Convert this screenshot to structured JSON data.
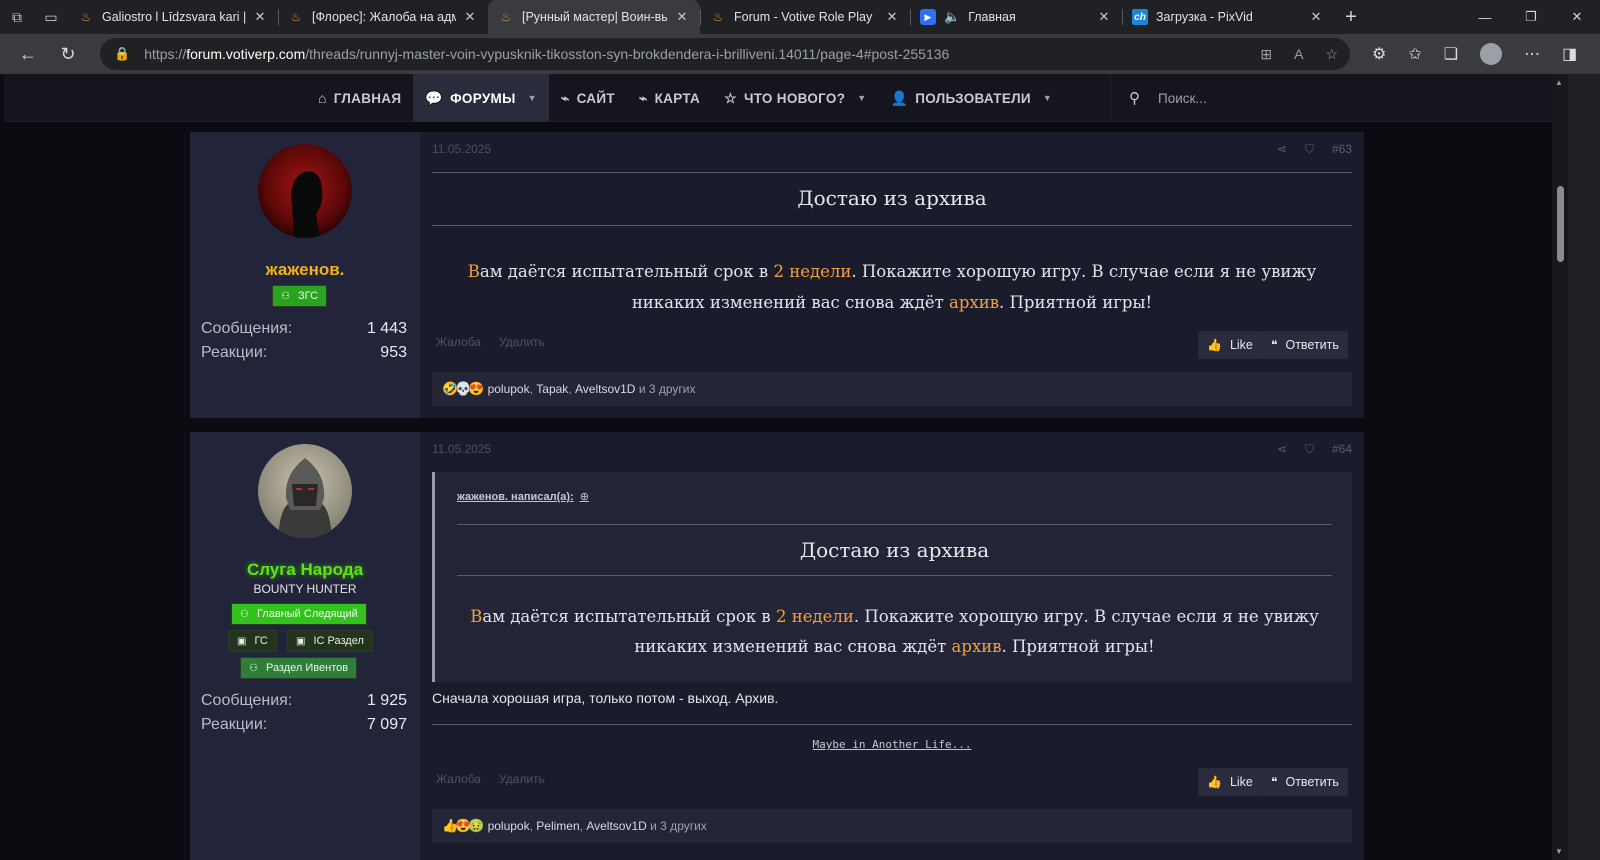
{
  "browser": {
    "tabs": [
      {
        "title": "Galiostro l Līdzsvara kari | Стр",
        "icon": "flame-favicon",
        "active": false
      },
      {
        "title": "[Флорес]: Жалоба на админ",
        "icon": "flame-favicon",
        "active": false
      },
      {
        "title": "[Рунный мастер| Воин-выпу",
        "icon": "flame-favicon",
        "active": true
      },
      {
        "title": "Forum - Votive Role Play",
        "icon": "flame-favicon",
        "active": false
      },
      {
        "title": "Главная",
        "icon": "play-favicon",
        "active": false
      },
      {
        "title": "Загрузка - PixVid",
        "icon": "ch-favicon",
        "active": false
      }
    ],
    "url_prefix": "https://",
    "url_host": "forum.votiverp.com",
    "url_path": "/threads/runnyj-master-voin-vypusknik-tikosston-syn-brokdendera-i-brilliveni.14011/page-4#post-255136"
  },
  "forum_nav": {
    "items": [
      {
        "label": "ГЛАВНАЯ",
        "icon": "home-icon",
        "selected": false,
        "caret": false
      },
      {
        "label": "ФОРУМЫ",
        "icon": "chat-icon",
        "selected": true,
        "caret": true
      },
      {
        "label": "САЙТ",
        "icon": "tag-icon",
        "selected": false,
        "caret": false
      },
      {
        "label": "КАРТА",
        "icon": "tag-icon",
        "selected": false,
        "caret": false
      },
      {
        "label": "ЧТО НОВОГО?",
        "icon": "star-icon",
        "selected": false,
        "caret": true
      },
      {
        "label": "ПОЛЬЗОВАТЕЛИ",
        "icon": "user-icon",
        "selected": false,
        "caret": true
      }
    ],
    "search_placeholder": "Поиск..."
  },
  "posts": [
    {
      "author": "жаженов.",
      "author_color": "#f0b21e",
      "badges": [
        {
          "label": "ЗГС"
        }
      ],
      "stats": {
        "messages_label": "Сообщения:",
        "messages": "1 443",
        "reactions_label": "Реакции:",
        "reactions": "953"
      },
      "date": "11.05.2025",
      "number": "#63",
      "title": "Достаю из архива",
      "body": {
        "p1": "В",
        "p2": "ам даётся испытательный срок в ",
        "p3": "2 недели",
        "p4": ". Покажите хорошую игру. В случае если я не увижу никаких изменений вас снова ждёт ",
        "p5": "архив",
        "p6": ". Приятной игры!"
      },
      "actions": {
        "report": "Жалоба",
        "delete": "Удалить",
        "like": "Like",
        "reply": "Ответить"
      },
      "reactions": {
        "emoji": "🤣💀😍",
        "names": [
          "polupok",
          "Tapak",
          "Aveltsov1D"
        ],
        "others": "и 3 других"
      }
    },
    {
      "author": "Слуга Народа",
      "author_color": "#5ee21a",
      "user_title": "BOUNTY HUNTER",
      "badges": [
        {
          "label": "Главный Следящий"
        },
        {
          "label": "ГС"
        },
        {
          "label": "IC Раздел"
        },
        {
          "label": "Раздел Ивентов"
        }
      ],
      "stats": {
        "messages_label": "Сообщения:",
        "messages": "1 925",
        "reactions_label": "Реакции:",
        "reactions": "7 097"
      },
      "date": "11.05.2025",
      "number": "#64",
      "quote": {
        "header": "жаженов. написал(а):",
        "title": "Достаю из архива",
        "p1": "В",
        "p2": "ам даётся испытательный срок в ",
        "p3": "2 недели",
        "p4": ". Покажите хорошую игру. В случае если я не увижу никаких изменений вас снова ждёт ",
        "p5": "архив",
        "p6": ". Приятной игры!"
      },
      "reply": "Сначала хорошая игра, только потом - выход. Архив.",
      "signature": "Maybe in Another Life...",
      "actions": {
        "report": "Жалоба",
        "delete": "Удалить",
        "like": "Like",
        "reply": "Ответить"
      },
      "reactions": {
        "emoji": "👍😍🤢",
        "names": [
          "polupok",
          "Pelimen",
          "Aveltsov1D"
        ],
        "others": "и 3 других"
      }
    }
  ],
  "colors": {
    "accent_orange": "#f5a03a",
    "nav_bg": "#14151e",
    "post_bg": "#1b1c2b",
    "user_cell_bg": "#22243a"
  }
}
